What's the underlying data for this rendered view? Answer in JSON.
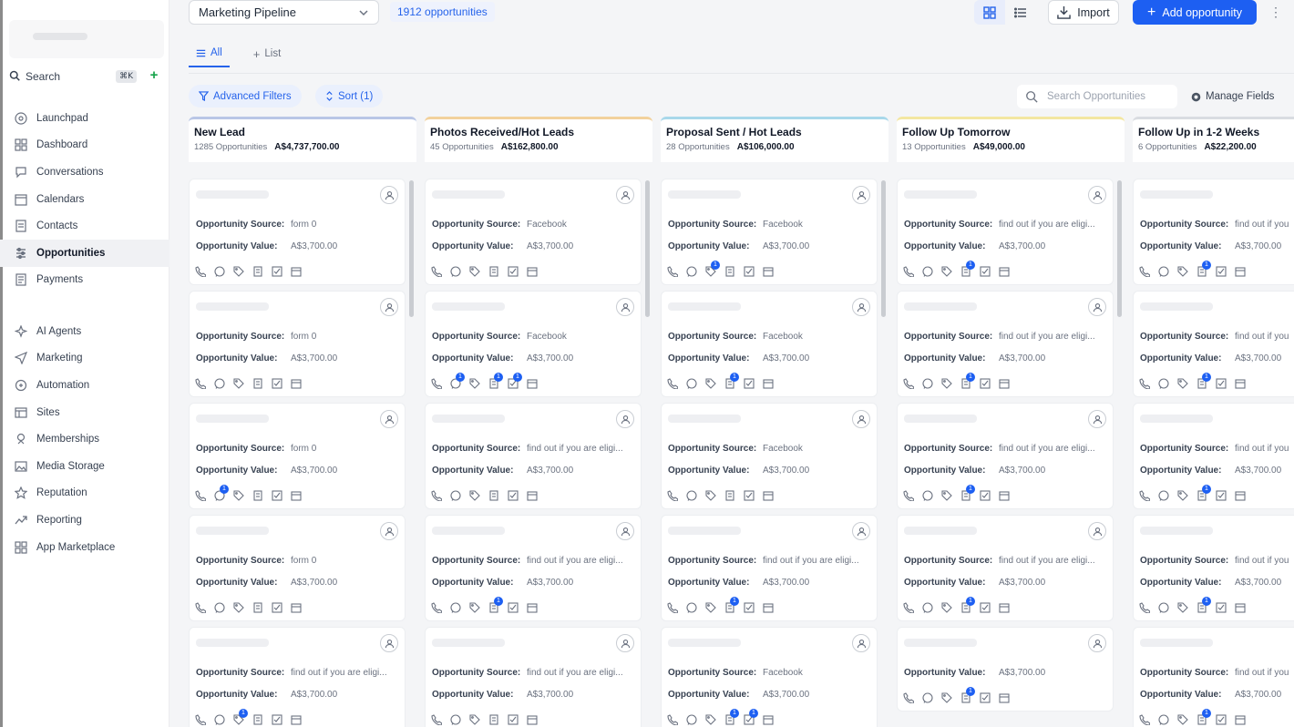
{
  "sidebar": {
    "search_label": "Search",
    "search_shortcut": "⌘K",
    "items": [
      {
        "label": "Launchpad",
        "icon": "launchpad-icon"
      },
      {
        "label": "Dashboard",
        "icon": "dashboard-icon"
      },
      {
        "label": "Conversations",
        "icon": "chat-icon"
      },
      {
        "label": "Calendars",
        "icon": "calendar-icon"
      },
      {
        "label": "Contacts",
        "icon": "contacts-icon"
      },
      {
        "label": "Opportunities",
        "icon": "opportunities-icon",
        "active": true
      },
      {
        "label": "Payments",
        "icon": "payments-icon"
      }
    ],
    "items2": [
      {
        "label": "AI Agents",
        "icon": "ai-agents-icon"
      },
      {
        "label": "Marketing",
        "icon": "marketing-icon"
      },
      {
        "label": "Automation",
        "icon": "automation-icon"
      },
      {
        "label": "Sites",
        "icon": "sites-icon"
      },
      {
        "label": "Memberships",
        "icon": "memberships-icon"
      },
      {
        "label": "Media Storage",
        "icon": "media-storage-icon"
      },
      {
        "label": "Reputation",
        "icon": "star-icon"
      },
      {
        "label": "Reporting",
        "icon": "reporting-icon"
      },
      {
        "label": "App Marketplace",
        "icon": "app-marketplace-icon"
      }
    ]
  },
  "header": {
    "pipeline": "Marketing Pipeline",
    "count": "1912 opportunities",
    "import_label": "Import",
    "add_label": "Add opportunity"
  },
  "tabs": [
    {
      "label": "All",
      "active": true
    },
    {
      "label": "List",
      "active": false
    }
  ],
  "filters": {
    "advanced_label": "Advanced Filters",
    "sort_label": "Sort (1)",
    "search_placeholder": "Search Opportunities",
    "manage_label": "Manage Fields"
  },
  "labels": {
    "source": "Opportunity Source:",
    "value": "Opportunity Value:"
  },
  "accent": "#1d5ff2",
  "columns": [
    {
      "title": "New Lead",
      "count": "1285 Opportunities",
      "amount": "A$4,737,700.00",
      "color": "#b9c6e6",
      "cards": [
        {
          "source": "form 0",
          "value": "A$3,700.00",
          "badges": []
        },
        {
          "source": "form 0",
          "value": "A$3,700.00",
          "badges": []
        },
        {
          "source": "form 0",
          "value": "A$3,700.00",
          "badges": [
            1
          ]
        },
        {
          "source": "form 0",
          "value": "A$3,700.00",
          "badges": []
        },
        {
          "source": "find out if you are eligi...",
          "value": "A$3,700.00",
          "badges": [
            2
          ]
        }
      ]
    },
    {
      "title": "Photos Received/Hot Leads",
      "count": "45 Opportunities",
      "amount": "A$162,800.00",
      "color": "#f2d19c",
      "cards": [
        {
          "source": "Facebook",
          "value": "A$3,700.00",
          "badges": []
        },
        {
          "source": "Facebook",
          "value": "A$3,700.00",
          "badges": [
            1,
            3,
            4
          ]
        },
        {
          "source": "find out if you are eligi...",
          "value": "A$3,700.00",
          "badges": []
        },
        {
          "source": "find out if you are eligi...",
          "value": "A$3,700.00",
          "badges": [
            3
          ]
        },
        {
          "source": "find out if you are eligi...",
          "value": "A$3,700.00",
          "badges": []
        }
      ]
    },
    {
      "title": "Proposal Sent / Hot Leads",
      "count": "28 Opportunities",
      "amount": "A$106,000.00",
      "color": "#a8d8ea",
      "cards": [
        {
          "source": "Facebook",
          "value": "A$3,700.00",
          "badges": [
            2
          ]
        },
        {
          "source": "Facebook",
          "value": "A$3,700.00",
          "badges": [
            3
          ]
        },
        {
          "source": "Facebook",
          "value": "A$3,700.00",
          "badges": []
        },
        {
          "source": "find out if you are eligi...",
          "value": "A$3,700.00",
          "badges": [
            3
          ]
        },
        {
          "source": "Facebook",
          "value": "A$3,700.00",
          "badges": [
            3,
            4
          ]
        }
      ]
    },
    {
      "title": "Follow Up Tomorrow",
      "count": "13 Opportunities",
      "amount": "A$49,000.00",
      "color": "#f3e7a1",
      "cards": [
        {
          "source": "find out if you are eligi...",
          "value": "A$3,700.00",
          "badges": [
            3
          ]
        },
        {
          "source": "find out if you are eligi...",
          "value": "A$3,700.00",
          "badges": [
            3
          ]
        },
        {
          "source": "find out if you are eligi...",
          "value": "A$3,700.00",
          "badges": [
            3
          ]
        },
        {
          "source": "find out if you are eligi...",
          "value": "A$3,700.00",
          "badges": [
            3
          ]
        },
        {
          "source": "",
          "value": "A$3,700.00",
          "badges": [
            3
          ]
        }
      ]
    },
    {
      "title": "Follow Up in 1-2 Weeks",
      "count": "6 Opportunities",
      "amount": "A$22,200.00",
      "color": "#d9dce1",
      "cards": [
        {
          "source": "find out if you",
          "value": "A$3,700.00",
          "badges": [
            3
          ]
        },
        {
          "source": "find out if you",
          "value": "A$3,700.00",
          "badges": [
            3
          ]
        },
        {
          "source": "find out if you",
          "value": "A$3,700.00",
          "badges": [
            3
          ]
        },
        {
          "source": "find out if you",
          "value": "A$3,700.00",
          "badges": [
            3
          ]
        },
        {
          "source": "find out if you",
          "value": "A$3,700.00",
          "badges": [
            3
          ]
        }
      ]
    }
  ]
}
